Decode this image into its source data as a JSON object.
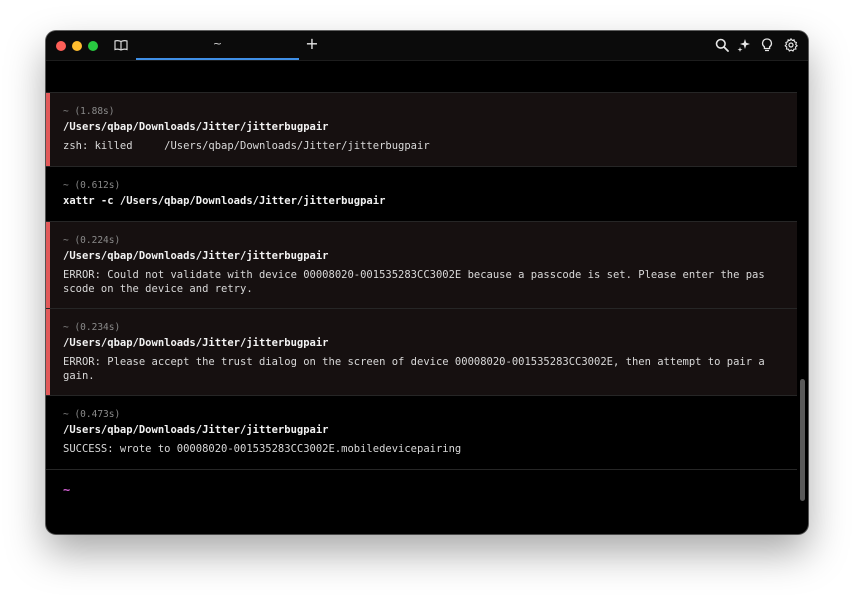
{
  "titlebar": {
    "tab_title": "~",
    "new_tab_label": "+",
    "left_icon": "book-icon",
    "right_icons": [
      "search-icon",
      "sparkle-icon",
      "lightbulb-icon",
      "gear-icon"
    ]
  },
  "colors": {
    "close": "#fe5f57",
    "minimize": "#febc2e",
    "zoom": "#28c840",
    "tab_accent": "#3f8fe6",
    "error_bar": "#e25a5a",
    "prompt": "#d05fd1"
  },
  "blocks": [
    {
      "status": "error",
      "duration": "~ (1.88s)",
      "command": "/Users/qbap/Downloads/Jitter/jitterbugpair",
      "output_lines": [
        "zsh: killed     /Users/qbap/Downloads/Jitter/jitterbugpair"
      ]
    },
    {
      "status": "success",
      "duration": "~ (0.612s)",
      "command": "xattr -c /Users/qbap/Downloads/Jitter/jitterbugpair",
      "output_lines": []
    },
    {
      "status": "error",
      "duration": "~ (0.224s)",
      "command": "/Users/qbap/Downloads/Jitter/jitterbugpair",
      "output_lines": [
        "ERROR: Could not validate with device 00008020-001535283CC3002E because a passcode is set. Please enter the pas",
        "scode on the device and retry."
      ]
    },
    {
      "status": "error",
      "duration": "~ (0.234s)",
      "command": "/Users/qbap/Downloads/Jitter/jitterbugpair",
      "output_lines": [
        "ERROR: Please accept the trust dialog on the screen of device 00008020-001535283CC3002E, then attempt to pair a",
        "gain."
      ]
    },
    {
      "status": "success",
      "duration": "~ (0.473s)",
      "command": "/Users/qbap/Downloads/Jitter/jitterbugpair",
      "output_lines": [
        "SUCCESS: wrote to 00008020-001535283CC3002E.mobiledevicepairing"
      ]
    }
  ],
  "prompt": "~"
}
